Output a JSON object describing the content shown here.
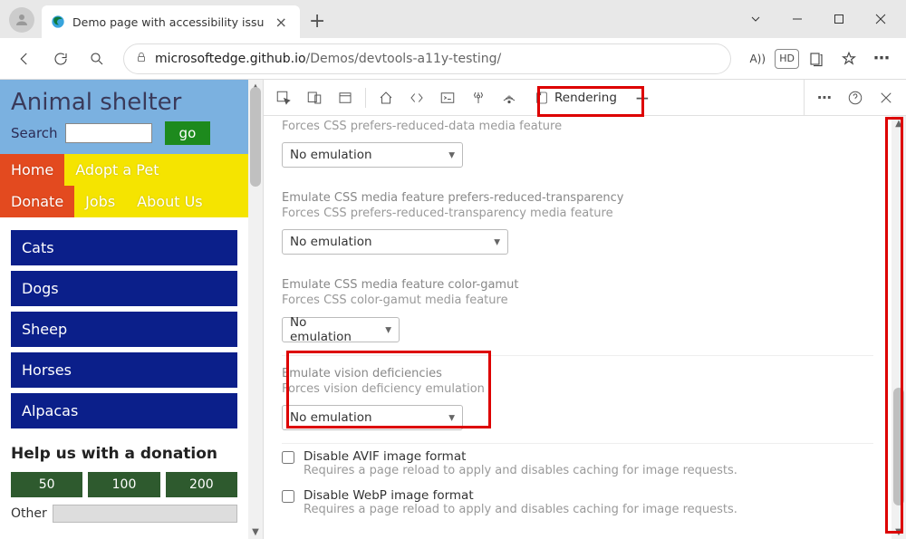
{
  "browser": {
    "tab_title": "Demo page with accessibility issu",
    "url_prefix": "microsoftedge.github.io",
    "url_path": "/Demos/devtools-a11y-testing/",
    "reader_badge": "A))",
    "hd_badge": "HD"
  },
  "page": {
    "title": "Animal shelter",
    "search_label": "Search",
    "go_button": "go",
    "nav": [
      "Home",
      "Adopt a Pet",
      "Donate",
      "Jobs",
      "About Us"
    ],
    "menu": [
      "Cats",
      "Dogs",
      "Sheep",
      "Horses",
      "Alpacas"
    ],
    "donate_heading": "Help us with a donation",
    "donate_amounts": [
      "50",
      "100",
      "200"
    ],
    "other_label": "Other"
  },
  "devtools": {
    "rendering_tab": "Rendering",
    "more_tabs_plus": "+",
    "groups": {
      "reduced_data": {
        "sub_partial": "Forces CSS prefers-reduced-data media feature",
        "value": "No emulation"
      },
      "reduced_transparency": {
        "title": "Emulate CSS media feature prefers-reduced-transparency",
        "sub": "Forces CSS prefers-reduced-transparency media feature",
        "value": "No emulation"
      },
      "color_gamut": {
        "title": "Emulate CSS media feature color-gamut",
        "sub": "Forces CSS color-gamut media feature",
        "value": "No emulation"
      },
      "vision": {
        "title": "Emulate vision deficiencies",
        "sub": "Forces vision deficiency emulation",
        "value": "No emulation"
      }
    },
    "checks": {
      "avif": {
        "label": "Disable AVIF image format",
        "sub": "Requires a page reload to apply and disables caching for image requests."
      },
      "webp": {
        "label": "Disable WebP image format",
        "sub": "Requires a page reload to apply and disables caching for image requests."
      }
    }
  }
}
